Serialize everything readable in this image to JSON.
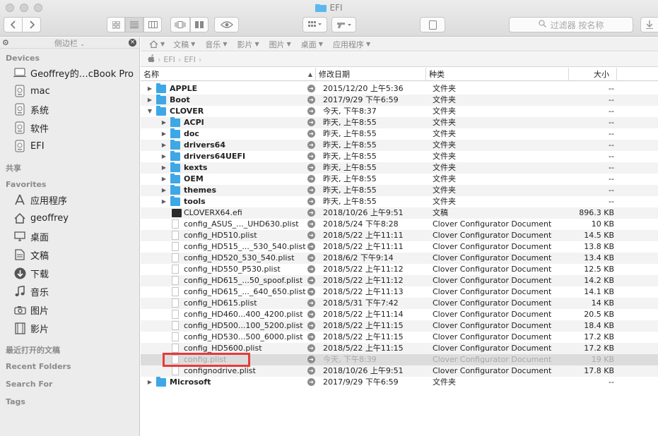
{
  "window": {
    "title": "EFI"
  },
  "toolbar": {
    "back_icon": "chevron-left-icon",
    "forward_icon": "chevron-right-icon",
    "search_placeholder": "过滤器 按名称"
  },
  "sidebar": {
    "header_title": "侧边栏",
    "devices_label": "Devices",
    "devices": [
      {
        "label": "Geoffrey的…cBook Pro",
        "icon": "laptop-icon"
      },
      {
        "label": "mac",
        "icon": "disk-icon"
      },
      {
        "label": "系统",
        "icon": "disk-icon"
      },
      {
        "label": "软件",
        "icon": "disk-icon"
      },
      {
        "label": "EFI",
        "icon": "disk-icon"
      }
    ],
    "shared_label": "共享",
    "favorites_label": "Favorites",
    "favorites": [
      {
        "label": "应用程序",
        "icon": "applications-icon"
      },
      {
        "label": "geoffrey",
        "icon": "home-icon"
      },
      {
        "label": "桌面",
        "icon": "desktop-icon"
      },
      {
        "label": "文稿",
        "icon": "documents-icon"
      },
      {
        "label": "下载",
        "icon": "download-icon"
      },
      {
        "label": "音乐",
        "icon": "music-icon"
      },
      {
        "label": "图片",
        "icon": "camera-icon"
      },
      {
        "label": "影片",
        "icon": "film-icon"
      }
    ],
    "recent_docs_label": "最近打开的文稿",
    "recent_folders_label": "Recent Folders",
    "search_for_label": "Search For",
    "tags_label": "Tags"
  },
  "tagbar": {
    "items": [
      "文稿",
      "音乐",
      "影片",
      "图片",
      "桌面",
      "应用程序"
    ]
  },
  "pathbar": {
    "items": [
      "EFI",
      "EFI"
    ]
  },
  "columns": {
    "name": "名称",
    "date": "修改日期",
    "kind": "种类",
    "size": "大小"
  },
  "files": [
    {
      "name": "APPLE",
      "date": "2015/12/20 上午5:36",
      "kind": "文件夹",
      "size": "--",
      "type": "folder",
      "level": 0,
      "disclosure": "closed",
      "bold": true
    },
    {
      "name": "Boot",
      "date": "2017/9/29 下午6:59",
      "kind": "文件夹",
      "size": "--",
      "type": "folder",
      "level": 0,
      "disclosure": "closed",
      "bold": true
    },
    {
      "name": "CLOVER",
      "date": "今天, 下午8:37",
      "kind": "文件夹",
      "size": "--",
      "type": "folder",
      "level": 0,
      "disclosure": "open",
      "bold": true
    },
    {
      "name": "ACPI",
      "date": "昨天, 上午8:55",
      "kind": "文件夹",
      "size": "--",
      "type": "folder",
      "level": 1,
      "disclosure": "closed",
      "bold": true
    },
    {
      "name": "doc",
      "date": "昨天, 上午8:55",
      "kind": "文件夹",
      "size": "--",
      "type": "folder",
      "level": 1,
      "disclosure": "closed",
      "bold": true
    },
    {
      "name": "drivers64",
      "date": "昨天, 上午8:55",
      "kind": "文件夹",
      "size": "--",
      "type": "folder",
      "level": 1,
      "disclosure": "closed",
      "bold": true
    },
    {
      "name": "drivers64UEFI",
      "date": "昨天, 上午8:55",
      "kind": "文件夹",
      "size": "--",
      "type": "folder",
      "level": 1,
      "disclosure": "closed",
      "bold": true
    },
    {
      "name": "kexts",
      "date": "昨天, 上午8:55",
      "kind": "文件夹",
      "size": "--",
      "type": "folder",
      "level": 1,
      "disclosure": "closed",
      "bold": true
    },
    {
      "name": "OEM",
      "date": "昨天, 上午8:55",
      "kind": "文件夹",
      "size": "--",
      "type": "folder",
      "level": 1,
      "disclosure": "closed",
      "bold": true
    },
    {
      "name": "themes",
      "date": "昨天, 上午8:55",
      "kind": "文件夹",
      "size": "--",
      "type": "folder",
      "level": 1,
      "disclosure": "closed",
      "bold": true
    },
    {
      "name": "tools",
      "date": "昨天, 上午8:55",
      "kind": "文件夹",
      "size": "--",
      "type": "folder",
      "level": 1,
      "disclosure": "closed",
      "bold": true
    },
    {
      "name": "CLOVERX64.efi",
      "date": "2018/10/26 上午9:51",
      "kind": "文稿",
      "size": "896.3 KB",
      "type": "exe",
      "level": 1
    },
    {
      "name": "config_ASUS_..._UHD630.plist",
      "date": "2018/5/24 下午8:28",
      "kind": "Clover Configurator Document",
      "size": "10 KB",
      "type": "doc",
      "level": 1
    },
    {
      "name": "config_HD510.plist",
      "date": "2018/5/22 上午11:11",
      "kind": "Clover Configurator Document",
      "size": "14.5 KB",
      "type": "doc",
      "level": 1
    },
    {
      "name": "config_HD515_..._530_540.plist",
      "date": "2018/5/22 上午11:11",
      "kind": "Clover Configurator Document",
      "size": "13.8 KB",
      "type": "doc",
      "level": 1
    },
    {
      "name": "config_HD520_530_540.plist",
      "date": "2018/6/2 下午9:14",
      "kind": "Clover Configurator Document",
      "size": "13.4 KB",
      "type": "doc",
      "level": 1
    },
    {
      "name": "config_HD550_P530.plist",
      "date": "2018/5/22 上午11:12",
      "kind": "Clover Configurator Document",
      "size": "12.5 KB",
      "type": "doc",
      "level": 1
    },
    {
      "name": "config_HD615_...50_spoof.plist",
      "date": "2018/5/22 上午11:12",
      "kind": "Clover Configurator Document",
      "size": "14.2 KB",
      "type": "doc",
      "level": 1
    },
    {
      "name": "config_HD615_..._640_650.plist",
      "date": "2018/5/22 上午11:13",
      "kind": "Clover Configurator Document",
      "size": "14.1 KB",
      "type": "doc",
      "level": 1
    },
    {
      "name": "config_HD615.plist",
      "date": "2018/5/31 下午7:42",
      "kind": "Clover Configurator Document",
      "size": "14 KB",
      "type": "doc",
      "level": 1
    },
    {
      "name": "config_HD460...400_4200.plist",
      "date": "2018/5/22 上午11:14",
      "kind": "Clover Configurator Document",
      "size": "20.5 KB",
      "type": "doc",
      "level": 1
    },
    {
      "name": "config_HD500...100_5200.plist",
      "date": "2018/5/22 上午11:15",
      "kind": "Clover Configurator Document",
      "size": "18.4 KB",
      "type": "doc",
      "level": 1
    },
    {
      "name": "config_HD530...500_6000.plist",
      "date": "2018/5/22 上午11:15",
      "kind": "Clover Configurator Document",
      "size": "17.2 KB",
      "type": "doc",
      "level": 1
    },
    {
      "name": "config_HD5600.plist",
      "date": "2018/5/22 上午11:15",
      "kind": "Clover Configurator Document",
      "size": "17.2 KB",
      "type": "doc",
      "level": 1
    },
    {
      "name": "config.plist",
      "date": "今天, 下午8:39",
      "kind": "Clover Configurator Document",
      "size": "19 KB",
      "type": "doc",
      "level": 1,
      "dimmed": true,
      "highlighted": true
    },
    {
      "name": "confignodrive.plist",
      "date": "2018/10/26 上午9:51",
      "kind": "Clover Configurator Document",
      "size": "17.8 KB",
      "type": "doc",
      "level": 1
    },
    {
      "name": "Microsoft",
      "date": "2017/9/29 下午6:59",
      "kind": "文件夹",
      "size": "--",
      "type": "folder",
      "level": 0,
      "disclosure": "closed",
      "bold": true
    }
  ],
  "colors": {
    "folder": "#3ea7e6",
    "highlight_border": "#e53b3b",
    "dimmed_row": "#dcdcdc"
  }
}
